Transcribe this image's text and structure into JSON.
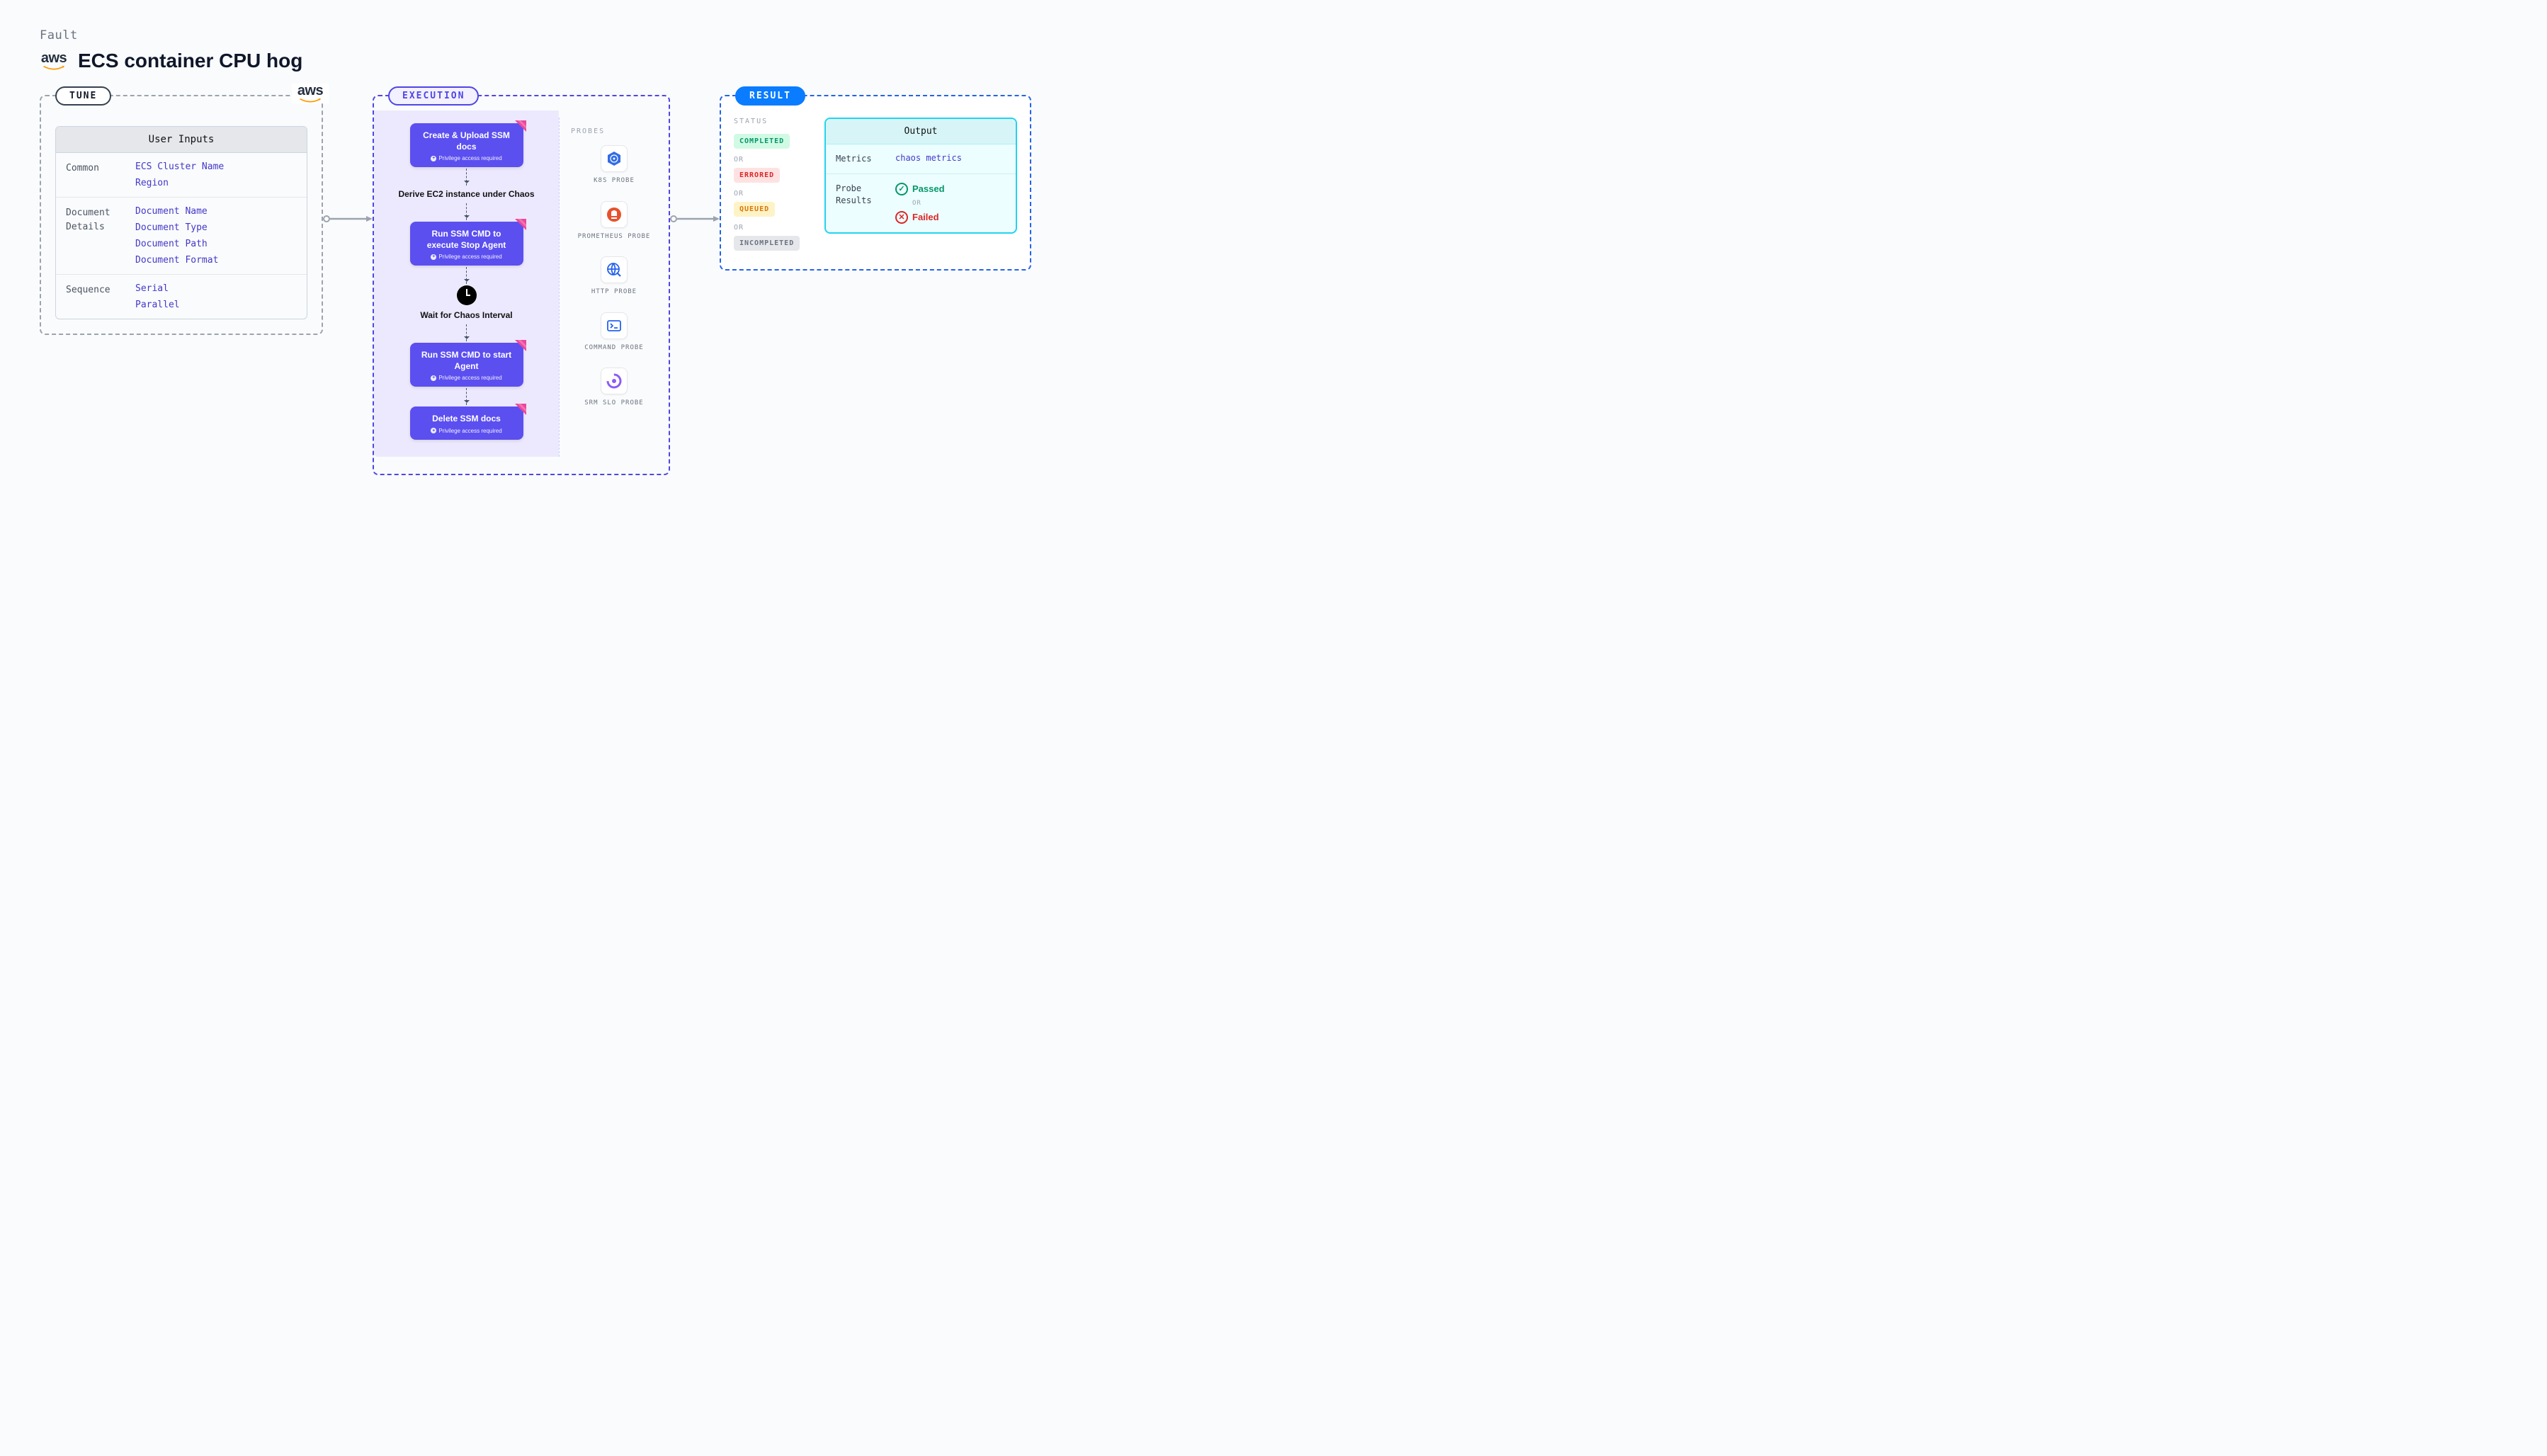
{
  "fault_label": "Fault",
  "title": "ECS container CPU hog",
  "tune": {
    "label": "TUNE",
    "card_title": "User Inputs",
    "sections": [
      {
        "label": "Common",
        "items": [
          "ECS Cluster Name",
          "Region"
        ]
      },
      {
        "label": "Document Details",
        "items": [
          "Document Name",
          "Document Type",
          "Document Path",
          "Document Format"
        ]
      },
      {
        "label": "Sequence",
        "items": [
          "Serial",
          "Parallel"
        ]
      }
    ]
  },
  "execution": {
    "label": "EXECUTION",
    "priv_text": "Privilege access required",
    "steps": {
      "s1": "Create & Upload SSM docs",
      "s2": "Derive EC2 instance under Chaos",
      "s3": "Run SSM CMD to execute Stop Agent",
      "s4": "Wait for Chaos Interval",
      "s5": "Run SSM CMD to start Agent",
      "s6": "Delete SSM docs"
    },
    "probes_title": "PROBES",
    "probes": [
      {
        "label": "K8S PROBE",
        "icon": "k8s"
      },
      {
        "label": "PROMETHEUS PROBE",
        "icon": "prom"
      },
      {
        "label": "HTTP PROBE",
        "icon": "http"
      },
      {
        "label": "COMMAND PROBE",
        "icon": "cmd"
      },
      {
        "label": "SRM SLO PROBE",
        "icon": "slo"
      }
    ]
  },
  "result": {
    "label": "RESULT",
    "status_title": "STATUS",
    "or": "OR",
    "statuses": {
      "completed": "COMPLETED",
      "errored": "ERRORED",
      "queued": "QUEUED",
      "incompleted": "INCOMPLETED"
    },
    "output_title": "Output",
    "metrics_label": "Metrics",
    "metrics_value": "chaos metrics",
    "probe_results_label": "Probe Results",
    "passed": "Passed",
    "failed": "Failed"
  }
}
